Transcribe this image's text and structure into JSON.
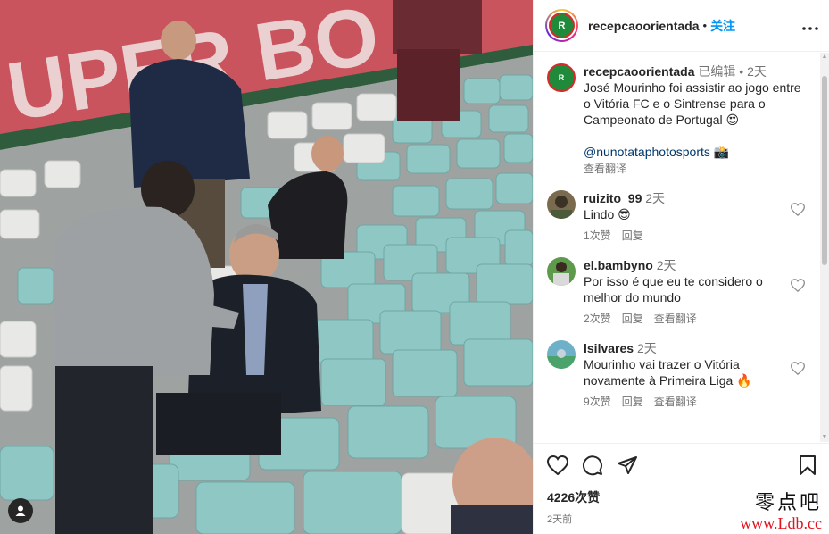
{
  "post": {
    "username": "recepcaoorientada",
    "dot": "•",
    "follow_label": "关注",
    "more_label": "•••",
    "logo_text": "R"
  },
  "caption": {
    "username": "recepcaoorientada",
    "edited": "已编辑",
    "dot": "•",
    "age": "2天",
    "text": "José Mourinho foi assistir ao jogo entre o Vitória FC e o Sintrense para o Campeonato de Portugal 😍",
    "mention": "@nunotataphotosports 📸",
    "translate": "查看翻译"
  },
  "comments": [
    {
      "username": "ruizito_99",
      "age": "2天",
      "text": "Lindo 😎",
      "likes": "1次赞",
      "reply": "回复",
      "translate": ""
    },
    {
      "username": "el.bambyno",
      "age": "2天",
      "text": "Por isso é que eu te considero o melhor do mundo",
      "likes": "2次赞",
      "reply": "回复",
      "translate": "查看翻译"
    },
    {
      "username": "lsilvares",
      "age": "2天",
      "text": "Mourinho vai trazer o Vitória novamente à Primeira Liga 🔥",
      "likes": "9次赞",
      "reply": "回复",
      "translate": "查看翻译"
    }
  ],
  "footer": {
    "likes": "4226次赞",
    "time": "2天前"
  },
  "watermark": {
    "cn": "零点吧",
    "url": "www.Ldb.cc"
  },
  "colors": {
    "follow": "#0095f6",
    "seat": "#8fc7c4",
    "banner": "#c9545e"
  },
  "icons": [
    "heart-icon",
    "comment-icon",
    "share-icon",
    "bookmark-icon",
    "more-icon",
    "user-tag-icon"
  ]
}
